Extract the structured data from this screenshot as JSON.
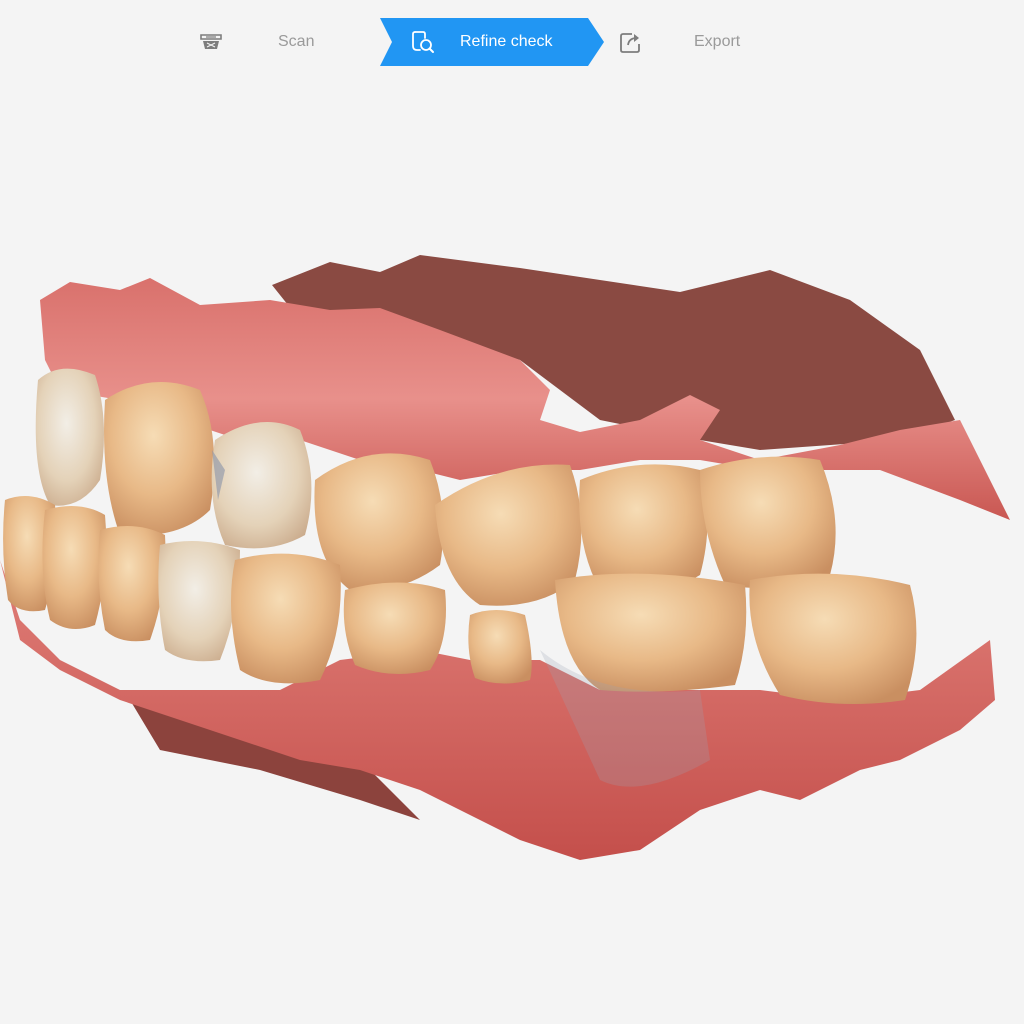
{
  "workflow": {
    "steps": [
      {
        "label": "Scan",
        "icon": "scan-icon",
        "state": "inactive"
      },
      {
        "label": "Refine check",
        "icon": "refine-check-icon",
        "state": "active"
      },
      {
        "label": "Export",
        "icon": "export-icon",
        "state": "inactive"
      }
    ],
    "active_color": "#2196f3",
    "inactive_text_color": "#9a9a9a"
  },
  "viewport": {
    "content": "3d-dental-scan-model"
  }
}
